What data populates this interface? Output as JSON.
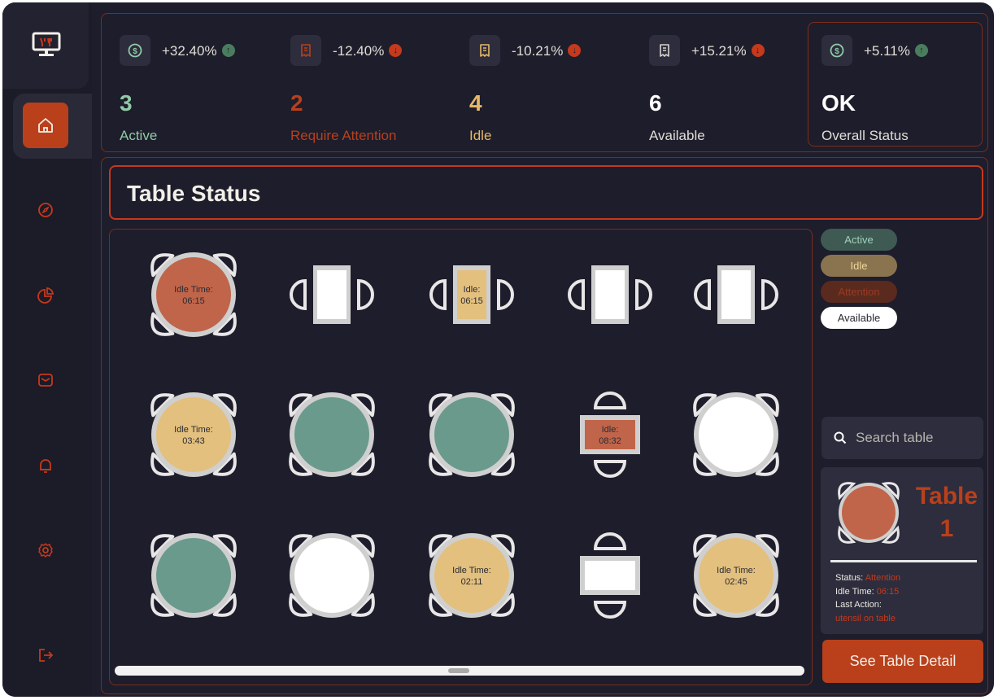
{
  "stats": [
    {
      "icon": "dollar-icon",
      "change": "+32.40%",
      "direction": "up",
      "value": "3",
      "label": "Active",
      "color": "#8fcaa6"
    },
    {
      "icon": "receipt-icon",
      "change": "-12.40%",
      "direction": "down",
      "value": "2",
      "label": "Require Attention",
      "color": "#b9401b"
    },
    {
      "icon": "receipt-icon",
      "change": "-10.21%",
      "direction": "down",
      "value": "4",
      "label": "Idle",
      "color": "#e6b96a"
    },
    {
      "icon": "receipt-icon",
      "change": "+15.21%",
      "direction": "down",
      "value": "6",
      "label": "Available",
      "color": "#ffffff"
    },
    {
      "icon": "dollar-icon",
      "change": "+5.11%",
      "direction": "up",
      "value": "OK",
      "label": "Overall Status",
      "color": "#ffffff"
    }
  ],
  "page_title": "Table Status",
  "legend": [
    {
      "label": "Active",
      "bg": "#3e5a52",
      "fg": "#9fd2bc"
    },
    {
      "label": "Idle",
      "bg": "#8a7450",
      "fg": "#f0d59a"
    },
    {
      "label": "Attention",
      "bg": "#5a2a1e",
      "fg": "#9a3b22"
    },
    {
      "label": "Available",
      "bg": "#ffffff",
      "fg": "#2a2a33"
    }
  ],
  "colors": {
    "attention": "#c0654a",
    "idle": "#e3c07e",
    "active": "#6a9a8c",
    "available": "#ffffff",
    "chair": "#e8e6e6",
    "accent": "#b9401b"
  },
  "tables": [
    {
      "shape": "round",
      "status": "attention",
      "text": [
        "Idle Time:",
        "06:15"
      ]
    },
    {
      "shape": "rect-side",
      "status": "available",
      "text": []
    },
    {
      "shape": "rect-side",
      "status": "idle",
      "text": [
        "Idle:",
        "06:15"
      ]
    },
    {
      "shape": "rect-side",
      "status": "available",
      "text": []
    },
    {
      "shape": "rect-side",
      "status": "available",
      "text": []
    },
    {
      "shape": "round",
      "status": "idle",
      "text": [
        "Idle Time:",
        "03:43"
      ]
    },
    {
      "shape": "round",
      "status": "active",
      "text": []
    },
    {
      "shape": "round",
      "status": "active",
      "text": []
    },
    {
      "shape": "rect-top",
      "status": "attention",
      "text": [
        "Idle:",
        "08:32"
      ]
    },
    {
      "shape": "round",
      "status": "available",
      "text": []
    },
    {
      "shape": "round",
      "status": "active",
      "text": []
    },
    {
      "shape": "round",
      "status": "available",
      "text": []
    },
    {
      "shape": "round",
      "status": "idle",
      "text": [
        "Idle Time:",
        "02:11"
      ]
    },
    {
      "shape": "rect-top",
      "status": "available",
      "text": []
    },
    {
      "shape": "round",
      "status": "idle",
      "text": [
        "Idle Time:",
        "02:45"
      ]
    }
  ],
  "search": {
    "placeholder": "Search table"
  },
  "detail": {
    "name_line1": "Table",
    "name_line2": "1",
    "status_label": "Status:",
    "status_value": "Attention",
    "idle_label": "Idle Time:",
    "idle_value": "06:15",
    "last_action_label": "Last Action:",
    "last_action_value": "utensil on table"
  },
  "see_detail_label": "See Table Detail",
  "nav": [
    "home-icon",
    "compass-icon",
    "pie-chart-icon",
    "mail-icon",
    "bell-icon",
    "settings-icon",
    "logout-icon"
  ]
}
